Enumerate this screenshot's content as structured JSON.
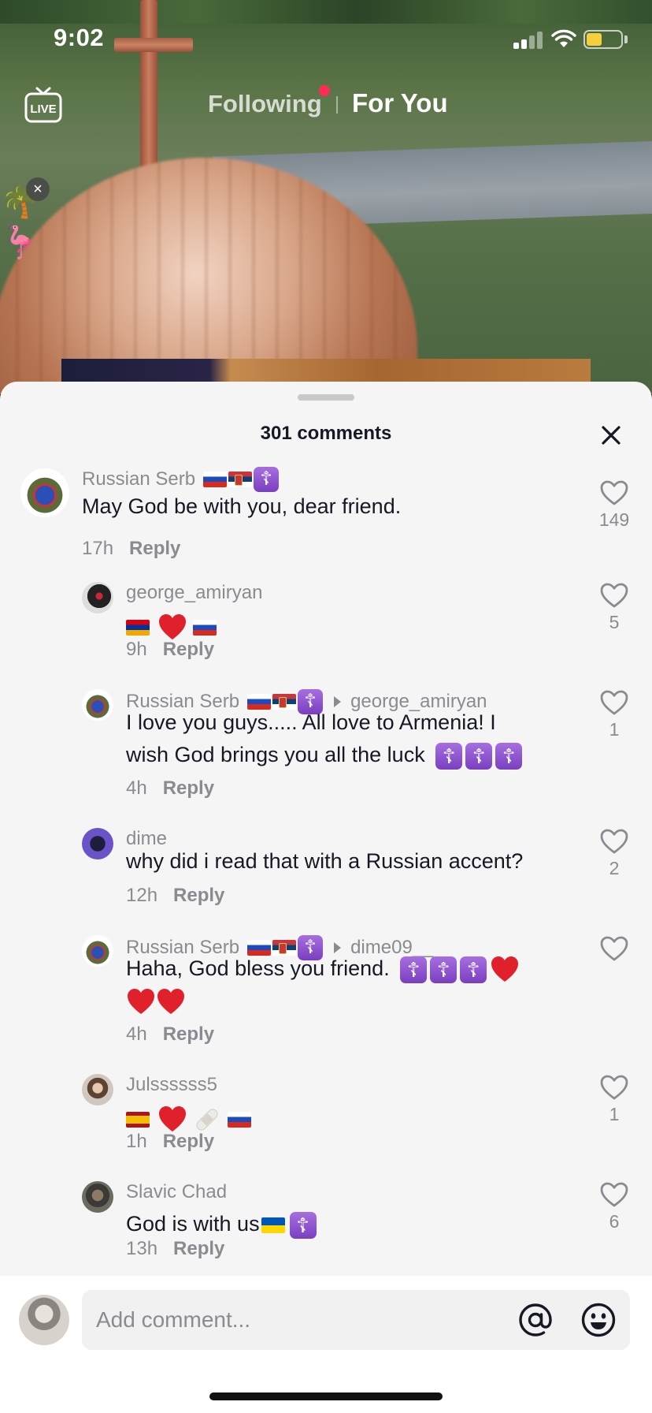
{
  "status_bar": {
    "time": "9:02"
  },
  "top_nav": {
    "live_label": "LIVE",
    "following_label": "Following",
    "for_you_label": "For You"
  },
  "comments_sheet": {
    "title": "301 comments",
    "comments": [
      {
        "username": "Russian Serb",
        "username_emojis": [
          "flag-russia",
          "flag-serbia",
          "orthodox-cross"
        ],
        "text": "May God be with you, dear friend.",
        "age": "17h",
        "reply_label": "Reply",
        "likes": "149"
      },
      {
        "username": "george_amiryan",
        "text_emojis": [
          "flag-armenia",
          "red-heart",
          "flag-russia"
        ],
        "age": "9h",
        "reply_label": "Reply",
        "likes": "5"
      },
      {
        "username": "Russian Serb",
        "username_emojis": [
          "flag-russia",
          "flag-serbia",
          "orthodox-cross"
        ],
        "reply_to": "george_amiryan",
        "text_line1": "I love you guys..... All love to Armenia! I",
        "text_line2": "wish God brings you all the luck",
        "age": "4h",
        "reply_label": "Reply",
        "likes": "1"
      },
      {
        "username": "dime",
        "text": "why did i read that with a Russian accent?",
        "age": "12h",
        "reply_label": "Reply",
        "likes": "2"
      },
      {
        "username": "Russian Serb",
        "username_emojis": [
          "flag-russia",
          "flag-serbia",
          "orthodox-cross"
        ],
        "reply_to": "dime09__",
        "text": "Haha, God bless you friend.",
        "age": "4h",
        "reply_label": "Reply",
        "likes": ""
      },
      {
        "username": "Julssssss5",
        "text_emojis": [
          "flag-spain",
          "red-heart",
          "adhesive-bandage",
          "flag-russia"
        ],
        "age": "1h",
        "reply_label": "Reply",
        "likes": "1"
      },
      {
        "username": "Slavic Chad",
        "text": "God is with us",
        "text_emojis": [
          "flag-ukraine",
          "orthodox-cross"
        ],
        "age": "13h",
        "reply_label": "Reply",
        "likes": "6"
      }
    ]
  },
  "comment_input": {
    "placeholder": "Add comment..."
  },
  "colors": {
    "accent_red": "#fe2c55",
    "sheet_bg": "#f6f5f5",
    "secondary_text": "#8a8b91",
    "primary_text": "#161823",
    "orthodox_cross_badge": "#8e52d4"
  },
  "icons": {
    "live": "live-tv-icon",
    "close": "close-icon",
    "like": "heart-outline-icon",
    "mention": "at-sign-icon",
    "emoji": "smiley-icon"
  }
}
